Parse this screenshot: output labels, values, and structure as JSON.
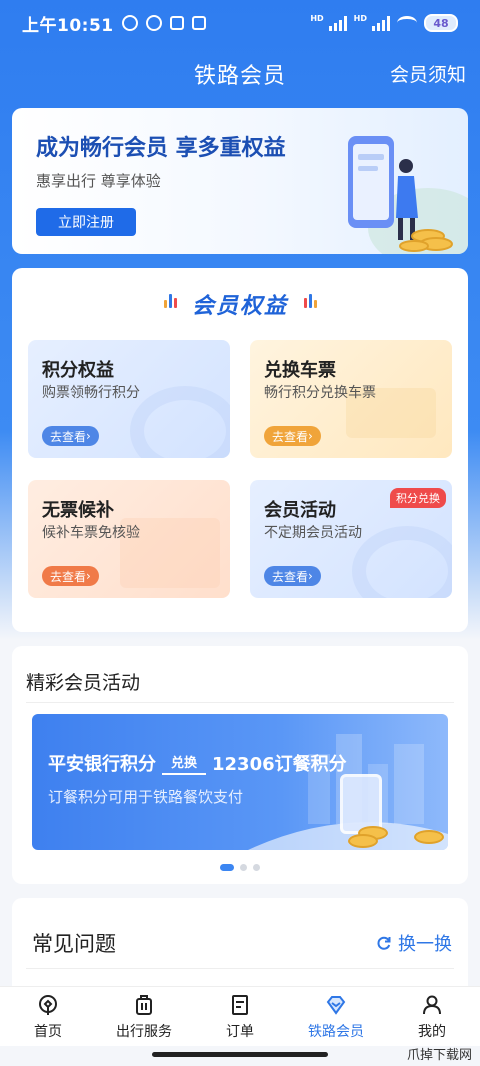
{
  "status": {
    "time": "上午10:51",
    "battery": "48"
  },
  "header": {
    "title": "铁路会员",
    "notice": "会员须知"
  },
  "banner": {
    "headline": "成为畅行会员 享多重权益",
    "sub": "惠享出行 尊享体验",
    "button": "立即注册"
  },
  "benefits": {
    "title": "会员权益",
    "tiles": [
      {
        "title": "积分权益",
        "sub": "购票领畅行积分",
        "button": "去查看"
      },
      {
        "title": "兑换车票",
        "sub": "畅行积分兑换车票",
        "button": "去查看"
      },
      {
        "title": "无票候补",
        "sub": "候补车票免核验",
        "button": "去查看"
      },
      {
        "title": "会员活动",
        "sub": "不定期会员活动",
        "button": "去查看",
        "badge": "积分兑换"
      }
    ]
  },
  "activities": {
    "title": "精彩会员活动",
    "promo": {
      "from": "平安银行积分",
      "arrow_label": "兑换",
      "to": "12306订餐积分",
      "sub": "订餐积分可用于铁路餐饮支付"
    }
  },
  "faq": {
    "title": "常见问题",
    "refresh": "换一换"
  },
  "tabbar": [
    {
      "label": "首页",
      "icon": "home-icon"
    },
    {
      "label": "出行服务",
      "icon": "luggage-icon"
    },
    {
      "label": "订单",
      "icon": "order-icon"
    },
    {
      "label": "铁路会员",
      "icon": "diamond-icon",
      "active": true
    },
    {
      "label": "我的",
      "icon": "profile-icon"
    }
  ],
  "watermark": "爪掉下载网",
  "colors": {
    "primary": "#2f77e6",
    "header_bg": "#2f7df0"
  }
}
